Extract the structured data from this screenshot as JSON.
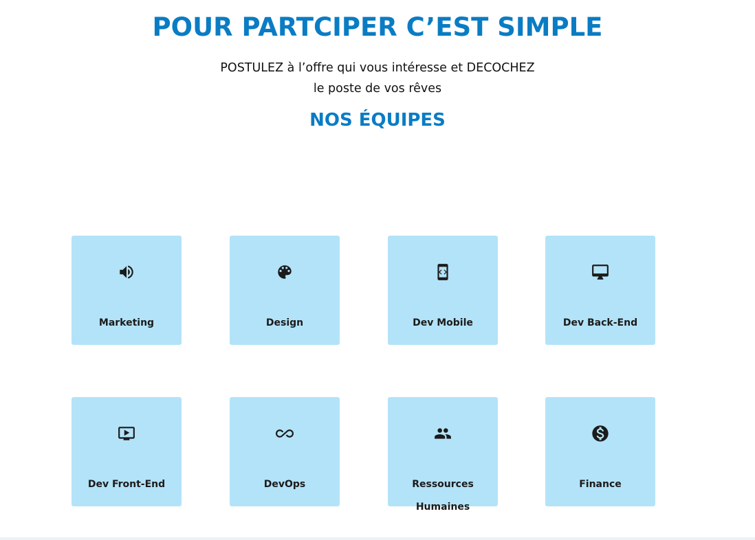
{
  "header": {
    "title": "POUR PARTCIPER C’EST SIMPLE",
    "intro_line1": "POSTULEZ à l’offre qui vous intéresse et DECOCHEZ",
    "intro_line2": "le poste de vos rêves",
    "section_title": "NOS ÉQUIPES"
  },
  "teams": [
    {
      "label": "Marketing",
      "icon": "speaker-icon"
    },
    {
      "label": "Design",
      "icon": "palette-icon"
    },
    {
      "label": "Dev Mobile",
      "icon": "mobile-code-icon"
    },
    {
      "label": "Dev Back-End",
      "icon": "desktop-monitor-icon"
    },
    {
      "label": "Dev Front-End",
      "icon": "video-screen-icon"
    },
    {
      "label": "DevOps",
      "icon": "infinity-icon"
    },
    {
      "label": "Ressources Humaines",
      "icon": "people-icon"
    },
    {
      "label": "Finance",
      "icon": "dollar-coin-icon"
    }
  ],
  "colors": {
    "brand_blue": "#0A7CC4",
    "card_background": "#B3E3F8",
    "text_dark": "#1b1b1b"
  }
}
